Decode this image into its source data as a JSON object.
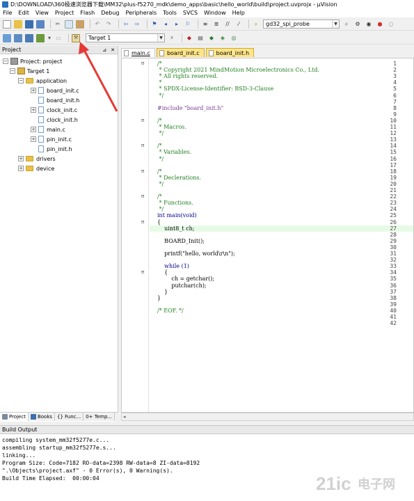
{
  "window": {
    "title": "D:\\DOWNLOAD\\360极速浏览器下载\\MM32\\plus-f5270_mdk\\demo_apps\\basic\\hello_world\\build\\project.uvprojx - µVision"
  },
  "menu": [
    "File",
    "Edit",
    "View",
    "Project",
    "Flash",
    "Debug",
    "Peripherals",
    "Tools",
    "SVCS",
    "Window",
    "Help"
  ],
  "toolbar": {
    "probe_combo": "gd32_spi_probe",
    "target_combo": "Target 1"
  },
  "project_panel": {
    "title": "Project",
    "pin_icon": "pin-icon",
    "close_icon": "close-icon",
    "tree": [
      {
        "label": "Project: project",
        "kind": "project",
        "expand": "−"
      },
      {
        "label": "Target 1",
        "kind": "target",
        "expand": "−"
      },
      {
        "label": "application",
        "kind": "folder",
        "expand": "−"
      },
      {
        "label": "board_init.c",
        "kind": "file",
        "expand": "+"
      },
      {
        "label": "board_init.h",
        "kind": "file",
        "expand": ""
      },
      {
        "label": "clock_init.c",
        "kind": "file",
        "expand": "+"
      },
      {
        "label": "clock_init.h",
        "kind": "file",
        "expand": ""
      },
      {
        "label": "main.c",
        "kind": "file",
        "expand": "+"
      },
      {
        "label": "pin_init.c",
        "kind": "file",
        "expand": "+"
      },
      {
        "label": "pin_init.h",
        "kind": "file",
        "expand": ""
      },
      {
        "label": "drivers",
        "kind": "folder",
        "expand": "+"
      },
      {
        "label": "device",
        "kind": "folder",
        "expand": "+"
      }
    ],
    "bottom_tabs": [
      "Project",
      "Books",
      "{} Func...",
      "0+ Temp..."
    ]
  },
  "editor": {
    "tabs": [
      "main.c",
      "board_init.c",
      "board_init.h"
    ],
    "active_tab": "main.c",
    "lines": [
      {
        "n": "1",
        "fold": "⊟",
        "text": "/*",
        "cls": "cm"
      },
      {
        "n": "2",
        "fold": "",
        "text": " * Copyright 2021 MindMotion Microelectronics Co., Ltd.",
        "cls": "cm"
      },
      {
        "n": "3",
        "fold": "",
        "text": " * All rights reserved.",
        "cls": "cm"
      },
      {
        "n": "4",
        "fold": "",
        "text": " *",
        "cls": "cm"
      },
      {
        "n": "5",
        "fold": "",
        "text": " * SPDX-License-Identifier: BSD-3-Clause",
        "cls": "cm"
      },
      {
        "n": "6",
        "fold": "",
        "text": " */",
        "cls": "cm"
      },
      {
        "n": "7",
        "fold": "",
        "text": "",
        "cls": ""
      },
      {
        "n": "8",
        "fold": "",
        "text": "#include \"board_init.h\"",
        "cls": "pp"
      },
      {
        "n": "9",
        "fold": "",
        "text": "",
        "cls": ""
      },
      {
        "n": "10",
        "fold": "⊟",
        "text": "/*",
        "cls": "cm"
      },
      {
        "n": "11",
        "fold": "",
        "text": " * Macros.",
        "cls": "cm"
      },
      {
        "n": "12",
        "fold": "",
        "text": " */",
        "cls": "cm"
      },
      {
        "n": "13",
        "fold": "",
        "text": "",
        "cls": ""
      },
      {
        "n": "14",
        "fold": "⊟",
        "text": "/*",
        "cls": "cm"
      },
      {
        "n": "15",
        "fold": "",
        "text": " * Variables.",
        "cls": "cm"
      },
      {
        "n": "16",
        "fold": "",
        "text": " */",
        "cls": "cm"
      },
      {
        "n": "17",
        "fold": "",
        "text": "",
        "cls": ""
      },
      {
        "n": "18",
        "fold": "⊟",
        "text": "/*",
        "cls": "cm"
      },
      {
        "n": "19",
        "fold": "",
        "text": " * Declerations.",
        "cls": "cm"
      },
      {
        "n": "20",
        "fold": "",
        "text": " */",
        "cls": "cm"
      },
      {
        "n": "21",
        "fold": "",
        "text": "",
        "cls": ""
      },
      {
        "n": "22",
        "fold": "⊟",
        "text": "/*",
        "cls": "cm"
      },
      {
        "n": "23",
        "fold": "",
        "text": " * Functions.",
        "cls": "cm"
      },
      {
        "n": "24",
        "fold": "",
        "text": " */",
        "cls": "cm"
      },
      {
        "n": "25",
        "fold": "",
        "text": "int main(void)",
        "cls": "kw"
      },
      {
        "n": "26",
        "fold": "⊟",
        "text": "{",
        "cls": ""
      },
      {
        "n": "27",
        "fold": "",
        "text": "    uint8_t ch;",
        "cls": "",
        "hl": true
      },
      {
        "n": "28",
        "fold": "",
        "text": "",
        "cls": ""
      },
      {
        "n": "29",
        "fold": "",
        "text": "    BOARD_Init();",
        "cls": ""
      },
      {
        "n": "30",
        "fold": "",
        "text": "",
        "cls": ""
      },
      {
        "n": "31",
        "fold": "",
        "text": "    printf(\"hello, world\\r\\n\");",
        "cls": ""
      },
      {
        "n": "32",
        "fold": "",
        "text": "",
        "cls": ""
      },
      {
        "n": "33",
        "fold": "",
        "text": "    while (1)",
        "cls": "kw"
      },
      {
        "n": "34",
        "fold": "⊟",
        "text": "    {",
        "cls": ""
      },
      {
        "n": "35",
        "fold": "",
        "text": "        ch = getchar();",
        "cls": ""
      },
      {
        "n": "36",
        "fold": "",
        "text": "        putchar(ch);",
        "cls": ""
      },
      {
        "n": "37",
        "fold": "",
        "text": "    }",
        "cls": ""
      },
      {
        "n": "38",
        "fold": "",
        "text": "}",
        "cls": ""
      },
      {
        "n": "39",
        "fold": "",
        "text": "",
        "cls": ""
      },
      {
        "n": "40",
        "fold": "",
        "text": "/* EOF. */",
        "cls": "cm"
      },
      {
        "n": "41",
        "fold": "",
        "text": "",
        "cls": ""
      },
      {
        "n": "42",
        "fold": "",
        "text": "",
        "cls": ""
      }
    ]
  },
  "build_output": {
    "title": "Build Output",
    "lines": [
      "compiling system_mm32f5277e.c...",
      "assembling startup_mm32f5277e.s...",
      "linking...",
      "Program Size: Code=7182 RO-data=2398 RW-data=8 ZI-data=8192",
      "\".\\Objects\\project.axf\" - 0 Error(s), 0 Warning(s).",
      "Build Time Elapsed:  00:00:04"
    ]
  },
  "watermark": {
    "text": "21ic 电子网"
  },
  "colors": {
    "arrow": "#e53935",
    "comment": "#1f7f1f",
    "keyword": "#00008b",
    "tab_inactive": "#fde58a"
  }
}
